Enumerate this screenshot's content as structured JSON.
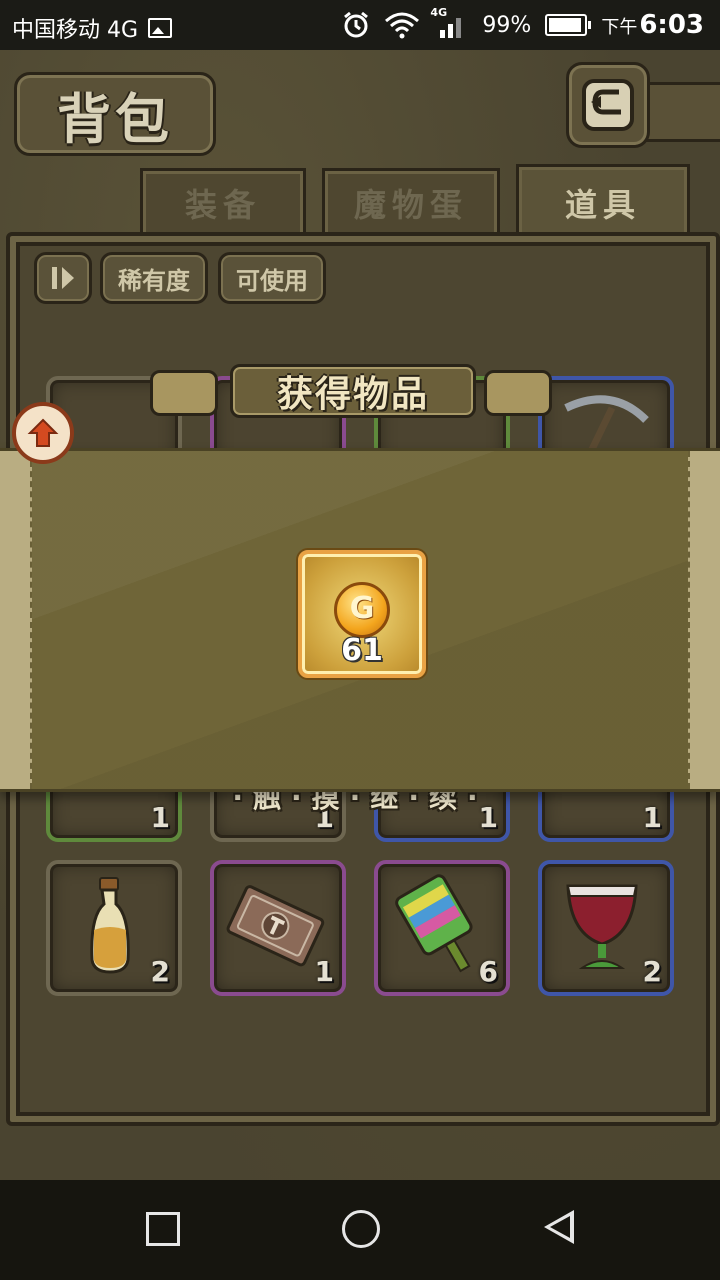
{
  "status_bar": {
    "carrier": "中国移动 4G",
    "network_badge": "4G",
    "battery": "99%",
    "time_prefix": "下午",
    "time": "6:03"
  },
  "header": {
    "title": "背包",
    "back_icon": "return-arrow-icon"
  },
  "tabs": [
    {
      "label": "装备",
      "active": false
    },
    {
      "label": "魔物蛋",
      "active": false
    },
    {
      "label": "道具",
      "active": true
    }
  ],
  "filters": {
    "sort_icon": "sort-pause-icon",
    "rarity_label": "稀有度",
    "usable_label": "可使用"
  },
  "inventory": {
    "row_counts": [
      "1",
      "1",
      "1",
      "1"
    ],
    "items": [
      {
        "name": "potion-bottle",
        "count": "2",
        "rarity": "grey"
      },
      {
        "name": "hammer-ticket",
        "count": "1",
        "rarity": "purple"
      },
      {
        "name": "popsicle",
        "count": "6",
        "rarity": "purple"
      },
      {
        "name": "wine-goblet",
        "count": "2",
        "rarity": "blue"
      }
    ]
  },
  "reward_popup": {
    "title": "获得物品",
    "item_icon": "gold-coin-icon",
    "coin_letter": "G",
    "count": "61",
    "continue_text": "·触·摸·继·续·"
  },
  "colors": {
    "accent_gold": "#e9a244",
    "parchment": "#6f6538",
    "rarity_green": "#5f8a3c",
    "rarity_purple": "#8a4b8f",
    "rarity_blue": "#3f56a8"
  }
}
